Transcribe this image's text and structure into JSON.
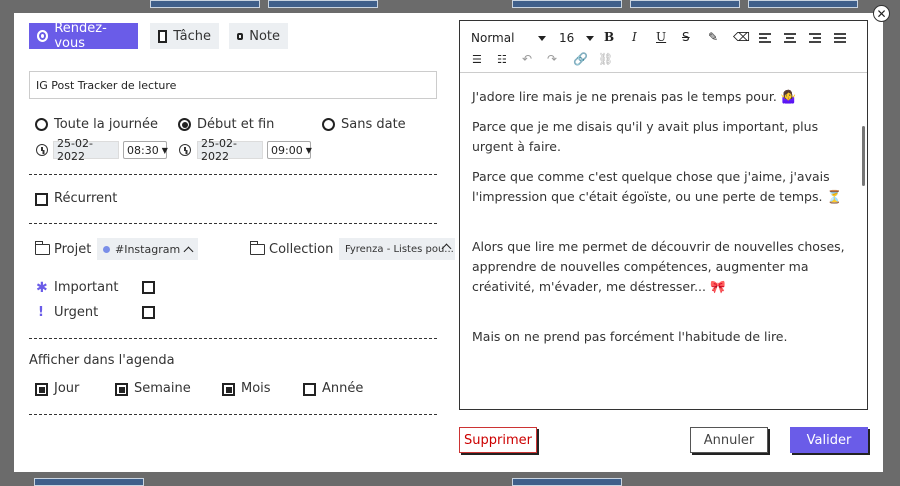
{
  "type_tabs": [
    {
      "label": "Rendez-vous",
      "active": true
    },
    {
      "label": "Tâche",
      "active": false
    },
    {
      "label": "Note",
      "active": false
    }
  ],
  "title_value": "IG Post Tracker de lecture",
  "timing": {
    "all_day": "Toute la journée",
    "start_end": "Début et fin",
    "no_date": "Sans date",
    "selected": "Début et fin",
    "start_date": "25-02-2022",
    "start_time": "08:30",
    "end_date": "25-02-2022",
    "end_time": "09:00"
  },
  "recurrent_label": "Récurrent",
  "project": {
    "label": "Projet",
    "value": "#Instagram"
  },
  "collection": {
    "label": "Collection",
    "value": "Fyrenza - Listes pou..."
  },
  "priority": {
    "important": "Important",
    "urgent": "Urgent"
  },
  "agenda": {
    "label": "Afficher dans l'agenda",
    "options": [
      {
        "label": "Jour",
        "checked": true
      },
      {
        "label": "Semaine",
        "checked": true
      },
      {
        "label": "Mois",
        "checked": true
      },
      {
        "label": "Année",
        "checked": false
      }
    ]
  },
  "editor": {
    "format": "Normal",
    "size": "16",
    "paragraphs": [
      "J'adore lire mais je ne prenais pas le temps pour. 🤷‍♀️",
      "Parce que je me disais qu'il y avait plus important, plus urgent à faire.",
      "Parce que comme c'est quelque chose que j'aime, j'avais l'impression que c'était égoïste, ou une perte de temps. ⏳",
      "Alors que lire me permet de découvrir de nouvelles choses, apprendre de nouvelles compétences, augmenter ma créativité, m'évader, me déstresser... 🎀",
      "Mais on ne prend pas forcément l'habitude de lire."
    ]
  },
  "buttons": {
    "delete": "Supprimer",
    "cancel": "Annuler",
    "validate": "Valider"
  },
  "colors": {
    "accent": "#6a5ce8",
    "danger": "#cc0000"
  }
}
